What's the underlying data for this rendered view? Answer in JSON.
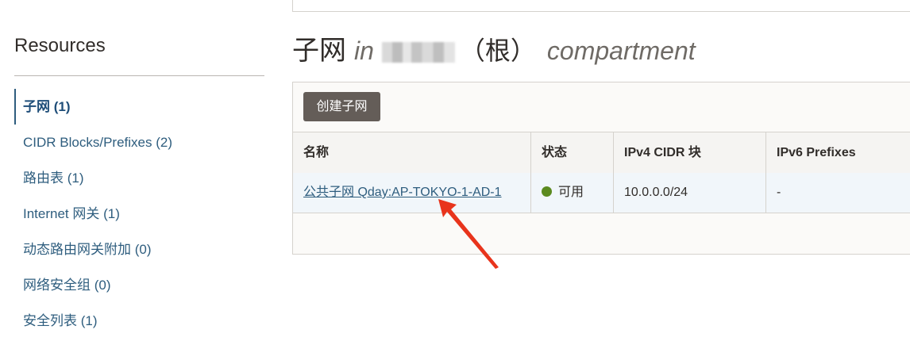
{
  "sidebar": {
    "title": "Resources",
    "items": [
      {
        "label": "子网 (1)",
        "active": true
      },
      {
        "label": "CIDR Blocks/Prefixes (2)"
      },
      {
        "label": "路由表 (1)"
      },
      {
        "label": "Internet 网关 (1)"
      },
      {
        "label": "动态路由网关附加 (0)"
      },
      {
        "label": "网络安全组 (0)"
      },
      {
        "label": "安全列表 (1)"
      }
    ]
  },
  "heading": {
    "title": "子网",
    "in": "in",
    "root": "（根）",
    "compartment": "compartment"
  },
  "panel": {
    "create_button": "创建子网",
    "columns": [
      "名称",
      "状态",
      "IPv4 CIDR 块",
      "IPv6 Prefixes"
    ],
    "rows": [
      {
        "name": "公共子网 Qday:AP-TOKYO-1-AD-1",
        "status": "可用",
        "ipv4": "10.0.0.0/24",
        "ipv6": "-"
      }
    ]
  },
  "colors": {
    "link": "#2e5d7e",
    "button_bg": "#645d58",
    "status_available": "#5b8a1f",
    "annotation_arrow": "#e8341c"
  }
}
